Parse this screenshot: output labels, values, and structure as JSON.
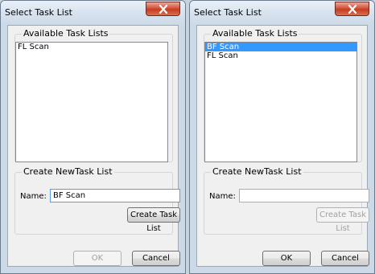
{
  "dialogs": [
    {
      "title": "Select Task List",
      "available_label": "Available Task Lists",
      "task_lists": [
        "FL Scan"
      ],
      "selected_index": -1,
      "create_label": "Create NewTask List",
      "name_label": "Name:",
      "name_value": "BF Scan",
      "create_button": "Create Task List",
      "create_enabled": true,
      "ok_button": "OK",
      "ok_enabled": false,
      "cancel_button": "Cancel"
    },
    {
      "title": "Select Task List",
      "available_label": "Available Task Lists",
      "task_lists": [
        "BF Scan",
        "FL Scan"
      ],
      "selected_index": 0,
      "create_label": "Create NewTask List",
      "name_label": "Name:",
      "name_value": "",
      "create_button": "Create Task List",
      "create_enabled": false,
      "ok_button": "OK",
      "ok_enabled": true,
      "cancel_button": "Cancel"
    }
  ],
  "colors": {
    "selection": "#3399ff",
    "close_button": "#c53b21",
    "focus_border": "#569de5"
  },
  "icons": {
    "close": "close-icon"
  }
}
